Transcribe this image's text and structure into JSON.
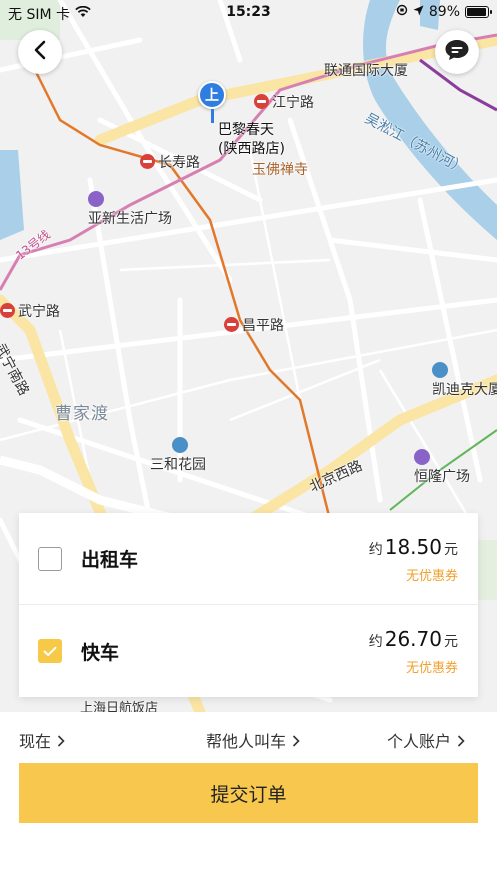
{
  "status_bar": {
    "carrier": "无 SIM 卡",
    "time": "15:23",
    "battery": "89%",
    "wifi_icon": "wifi-icon",
    "location_icon": "location-arrow-icon"
  },
  "map": {
    "labels": {
      "jiangning_road": "江宁路",
      "lianhe_tower": "联通国际大厦",
      "wusong_river": "吴淞江（苏州河）",
      "changshou_road": "长寿路",
      "yufo_temple": "玉佛禅寺",
      "yaxin_plaza": "亚新生活广场",
      "line13": "13号线",
      "wuning_road": "武宁路",
      "wuning_south_road": "武宁南路",
      "changping_road": "昌平路",
      "caojiadu": "曹家渡",
      "kaidike": "凯迪克大厦",
      "sanhe_garden": "三和花园",
      "beijing_west_road": "北京西路",
      "henglong_plaza": "恒隆广场",
      "shanghai_hotel": "上海日航饭店"
    },
    "pin": {
      "label": "上",
      "place_line1": "巴黎春天",
      "place_line2": "(陕西路店)"
    }
  },
  "ride_options": [
    {
      "name": "出租车",
      "price_prefix": "约",
      "amount": "18.50",
      "unit": "元",
      "coupon": "无优惠券",
      "checked": false
    },
    {
      "name": "快车",
      "price_prefix": "约",
      "amount": "26.70",
      "unit": "元",
      "coupon": "无优惠券",
      "checked": true
    }
  ],
  "options_bar": {
    "time": "现在",
    "call_for_others": "帮他人叫车",
    "account": "个人账户"
  },
  "submit_label": "提交订单",
  "colors": {
    "accent_yellow": "#f7c84d",
    "coupon_orange": "#f0a02e",
    "pin_blue": "#2f7de1",
    "metro_red": "#d8413a"
  }
}
